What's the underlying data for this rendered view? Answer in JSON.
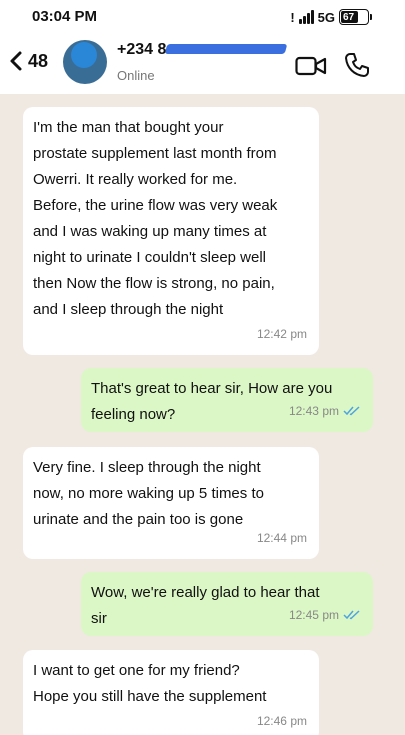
{
  "status_bar": {
    "time": "03:04 PM",
    "network": "5G",
    "battery": "67"
  },
  "header": {
    "back_count": "48",
    "contact_name": "+234 8",
    "contact_status": "Online"
  },
  "messages": [
    {
      "direction": "incoming",
      "text": "I'm the man that bought your\nprostate supplement last month from\nOwerri. It really worked for me.\nBefore, the urine flow was very weak\nand I was waking up many times at\nnight to urinate I couldn't sleep well\nthen Now the flow is strong, no pain,\nand I sleep through the night",
      "time": "12:42 pm"
    },
    {
      "direction": "outgoing",
      "text": "That's great to hear sir, How are you\nfeeling now?",
      "time": "12:43 pm",
      "read": true
    },
    {
      "direction": "incoming",
      "text": "Very fine. I sleep through the night\nnow, no more waking up 5 times to\nurinate and the pain too is gone",
      "time": "12:44 pm"
    },
    {
      "direction": "outgoing",
      "text": "Wow, we're really glad to hear that\nsir",
      "time": "12:45 pm",
      "read": true
    },
    {
      "direction": "incoming",
      "text": "I want to get one for my friend?\nHope you still have the supplement",
      "time": "12:46 pm"
    }
  ],
  "colors": {
    "background": "#efe9e2",
    "incoming_bubble": "#ffffff",
    "outgoing_bubble": "#dbf7c6",
    "read_tick": "#4fa3e0"
  }
}
